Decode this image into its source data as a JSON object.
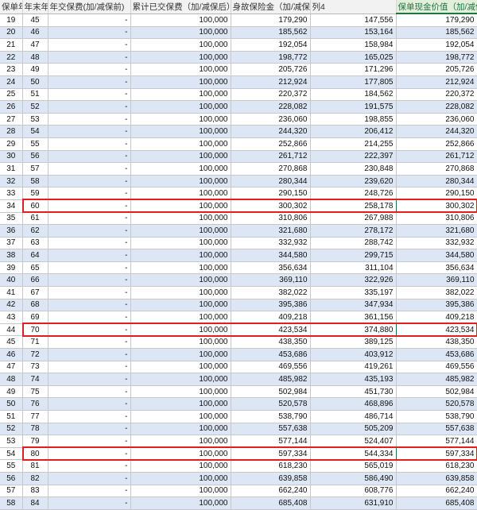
{
  "sheet": {
    "headers": [
      "保单年",
      "年末年",
      "年交保费(加/减保前)",
      "累计已交保费（加/减保后）",
      "身故保险金（加/减保前",
      "列4",
      "保单现金价值（加/减保后"
    ],
    "highlight_header_index": 6,
    "rows": [
      [
        "19",
        "45",
        "-",
        "100,000",
        "179,290",
        "147,556",
        "179,290"
      ],
      [
        "20",
        "46",
        "-",
        "100,000",
        "185,562",
        "153,164",
        "185,562"
      ],
      [
        "21",
        "47",
        "-",
        "100,000",
        "192,054",
        "158,984",
        "192,054"
      ],
      [
        "22",
        "48",
        "-",
        "100,000",
        "198,772",
        "165,025",
        "198,772"
      ],
      [
        "23",
        "49",
        "-",
        "100,000",
        "205,726",
        "171,296",
        "205,726"
      ],
      [
        "24",
        "50",
        "-",
        "100,000",
        "212,924",
        "177,805",
        "212,924"
      ],
      [
        "25",
        "51",
        "-",
        "100,000",
        "220,372",
        "184,562",
        "220,372"
      ],
      [
        "26",
        "52",
        "-",
        "100,000",
        "228,082",
        "191,575",
        "228,082"
      ],
      [
        "27",
        "53",
        "-",
        "100,000",
        "236,060",
        "198,855",
        "236,060"
      ],
      [
        "28",
        "54",
        "-",
        "100,000",
        "244,320",
        "206,412",
        "244,320"
      ],
      [
        "29",
        "55",
        "-",
        "100,000",
        "252,866",
        "214,255",
        "252,866"
      ],
      [
        "30",
        "56",
        "-",
        "100,000",
        "261,712",
        "222,397",
        "261,712"
      ],
      [
        "31",
        "57",
        "-",
        "100,000",
        "270,868",
        "230,848",
        "270,868"
      ],
      [
        "32",
        "58",
        "-",
        "100,000",
        "280,344",
        "239,620",
        "280,344"
      ],
      [
        "33",
        "59",
        "-",
        "100,000",
        "290,150",
        "248,726",
        "290,150"
      ],
      [
        "34",
        "60",
        "-",
        "100,000",
        "300,302",
        "258,178",
        "300,302"
      ],
      [
        "35",
        "61",
        "-",
        "100,000",
        "310,806",
        "267,988",
        "310,806"
      ],
      [
        "36",
        "62",
        "-",
        "100,000",
        "321,680",
        "278,172",
        "321,680"
      ],
      [
        "37",
        "63",
        "-",
        "100,000",
        "332,932",
        "288,742",
        "332,932"
      ],
      [
        "38",
        "64",
        "-",
        "100,000",
        "344,580",
        "299,715",
        "344,580"
      ],
      [
        "39",
        "65",
        "-",
        "100,000",
        "356,634",
        "311,104",
        "356,634"
      ],
      [
        "40",
        "66",
        "-",
        "100,000",
        "369,110",
        "322,926",
        "369,110"
      ],
      [
        "41",
        "67",
        "-",
        "100,000",
        "382,022",
        "335,197",
        "382,022"
      ],
      [
        "42",
        "68",
        "-",
        "100,000",
        "395,386",
        "347,934",
        "395,386"
      ],
      [
        "43",
        "69",
        "-",
        "100,000",
        "409,218",
        "361,156",
        "409,218"
      ],
      [
        "44",
        "70",
        "-",
        "100,000",
        "423,534",
        "374,880",
        "423,534"
      ],
      [
        "45",
        "71",
        "-",
        "100,000",
        "438,350",
        "389,125",
        "438,350"
      ],
      [
        "46",
        "72",
        "-",
        "100,000",
        "453,686",
        "403,912",
        "453,686"
      ],
      [
        "47",
        "73",
        "-",
        "100,000",
        "469,556",
        "419,261",
        "469,556"
      ],
      [
        "48",
        "74",
        "-",
        "100,000",
        "485,982",
        "435,193",
        "485,982"
      ],
      [
        "49",
        "75",
        "-",
        "100,000",
        "502,984",
        "451,730",
        "502,984"
      ],
      [
        "50",
        "76",
        "-",
        "100,000",
        "520,578",
        "468,896",
        "520,578"
      ],
      [
        "51",
        "77",
        "-",
        "100,000",
        "538,790",
        "486,714",
        "538,790"
      ],
      [
        "52",
        "78",
        "-",
        "100,000",
        "557,638",
        "505,209",
        "557,638"
      ],
      [
        "53",
        "79",
        "-",
        "100,000",
        "577,144",
        "524,407",
        "577,144"
      ],
      [
        "54",
        "80",
        "-",
        "100,000",
        "597,334",
        "544,334",
        "597,334"
      ],
      [
        "55",
        "81",
        "-",
        "100,000",
        "618,230",
        "565,019",
        "618,230"
      ],
      [
        "56",
        "82",
        "-",
        "100,000",
        "639,858",
        "586,490",
        "639,858"
      ],
      [
        "57",
        "83",
        "-",
        "100,000",
        "662,240",
        "608,776",
        "662,240"
      ],
      [
        "58",
        "84",
        "-",
        "100,000",
        "685,408",
        "631,910",
        "685,408"
      ]
    ],
    "highlighted_rows": [
      "60",
      "70",
      "80"
    ],
    "colors": {
      "highlight_border": "#e02020",
      "header_accent": "#217346",
      "band": "#dce6f4"
    }
  }
}
